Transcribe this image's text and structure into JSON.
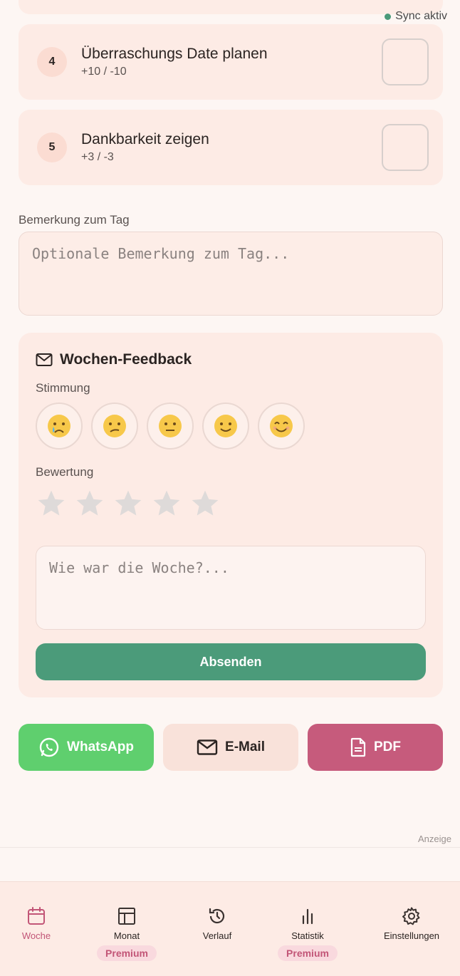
{
  "sync": {
    "label": "Sync aktiv",
    "color": "#4a9a7a"
  },
  "tasks": [
    {
      "number": "4",
      "title": "Überraschungs Date planen",
      "points": "+10 / -10"
    },
    {
      "number": "5",
      "title": "Dankbarkeit zeigen",
      "points": "+3 / -3"
    }
  ],
  "remark": {
    "label": "Bemerkung zum Tag",
    "placeholder": "Optionale Bemerkung zum Tag..."
  },
  "feedback": {
    "title": "Wochen-Feedback",
    "mood_label": "Stimmung",
    "moods": [
      "crying-face",
      "confused-face",
      "neutral-face",
      "slightly-smiling-face",
      "smiling-face"
    ],
    "rating_label": "Bewertung",
    "rating": 0,
    "rating_max": 5,
    "comment_placeholder": "Wie war die Woche?...",
    "submit_label": "Absenden",
    "accent": "#4b9b7a"
  },
  "share": {
    "whatsapp": {
      "label": "WhatsApp",
      "color": "#5fcf6e"
    },
    "email": {
      "label": "E-Mail",
      "color": "#f9e2da"
    },
    "pdf": {
      "label": "PDF",
      "color": "#c65b7c"
    }
  },
  "ad": {
    "label": "Anzeige"
  },
  "nav": {
    "items": [
      {
        "label": "Woche",
        "icon": "calendar-icon",
        "active": true
      },
      {
        "label": "Monat",
        "icon": "layout-icon",
        "badge": "Premium"
      },
      {
        "label": "Verlauf",
        "icon": "history-icon"
      },
      {
        "label": "Statistik",
        "icon": "bar-chart-icon",
        "badge": "Premium"
      },
      {
        "label": "Einstellungen",
        "icon": "gear-icon"
      }
    ],
    "active_color": "#c25577"
  }
}
